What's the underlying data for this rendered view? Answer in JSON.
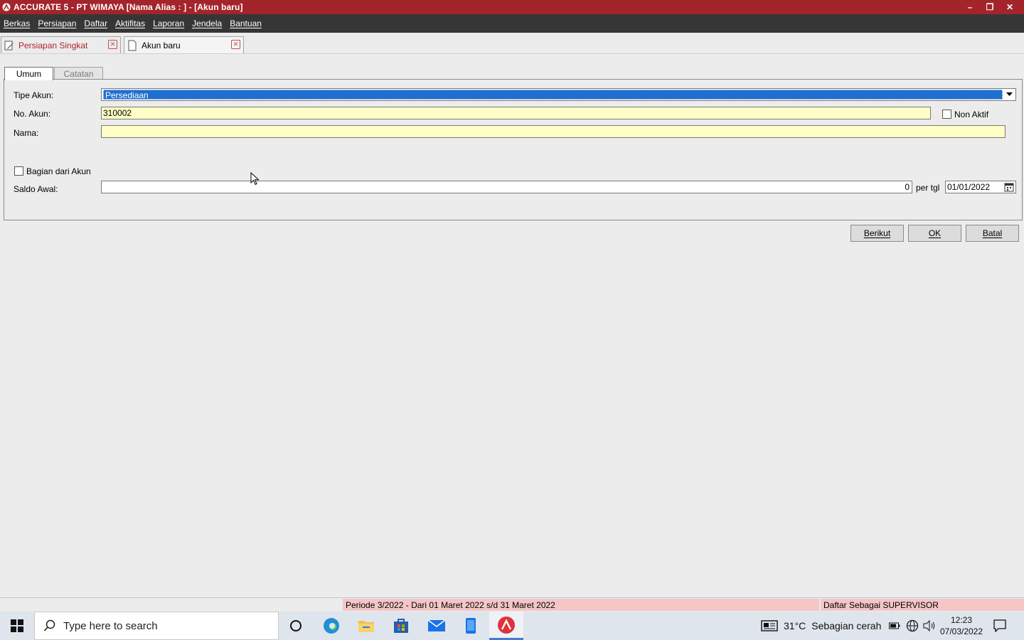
{
  "window": {
    "title": "ACCURATE 5  - PT WIMAYA  [Nama Alias : ] - [Akun baru]",
    "controls": {
      "minimize": "–",
      "restore": "❐",
      "close": "✕"
    }
  },
  "menu": [
    "Berkas",
    "Persiapan",
    "Daftar",
    "Aktifitas",
    "Laporan",
    "Jendela",
    "Bantuan"
  ],
  "doc_tabs": [
    {
      "label": "Persiapan Singkat",
      "icon": "form-edit-icon",
      "color": "#b0242b"
    },
    {
      "label": "Akun baru",
      "icon": "blank-page-icon",
      "color": "#000000"
    }
  ],
  "form_tabs": [
    "Umum",
    "Catatan"
  ],
  "form": {
    "tipe_akun_label": "Tipe Akun:",
    "tipe_akun_value": "Persediaan",
    "no_akun_label": "No. Akun:",
    "no_akun_value": "310002",
    "non_aktif_label": "Non Aktif",
    "nama_label": "Nama:",
    "nama_value": "",
    "bagian_label": "Bagian dari Akun",
    "saldo_label": "Saldo Awal:",
    "saldo_value": "0",
    "per_tgl_label": "per tgl",
    "date_value": "01/01/2022"
  },
  "buttons": {
    "next": "Berikut",
    "ok": "OK",
    "cancel": "Batal"
  },
  "status": {
    "periode": "Periode 3/2022 - Dari 01 Maret 2022 s/d 31 Maret 2022",
    "user": "Daftar Sebagai SUPERVISOR"
  },
  "taskbar": {
    "search_placeholder": "Type here to search",
    "weather_temp": "31°C",
    "weather_text": "Sebagian cerah",
    "time": "12:23",
    "date": "07/03/2022"
  },
  "colors": {
    "titlebar": "#a3242b",
    "menubar": "#363636",
    "input_yellow": "#fefec6",
    "selection_blue": "#1f6fd0",
    "status_pink": "#f4c6c6"
  }
}
